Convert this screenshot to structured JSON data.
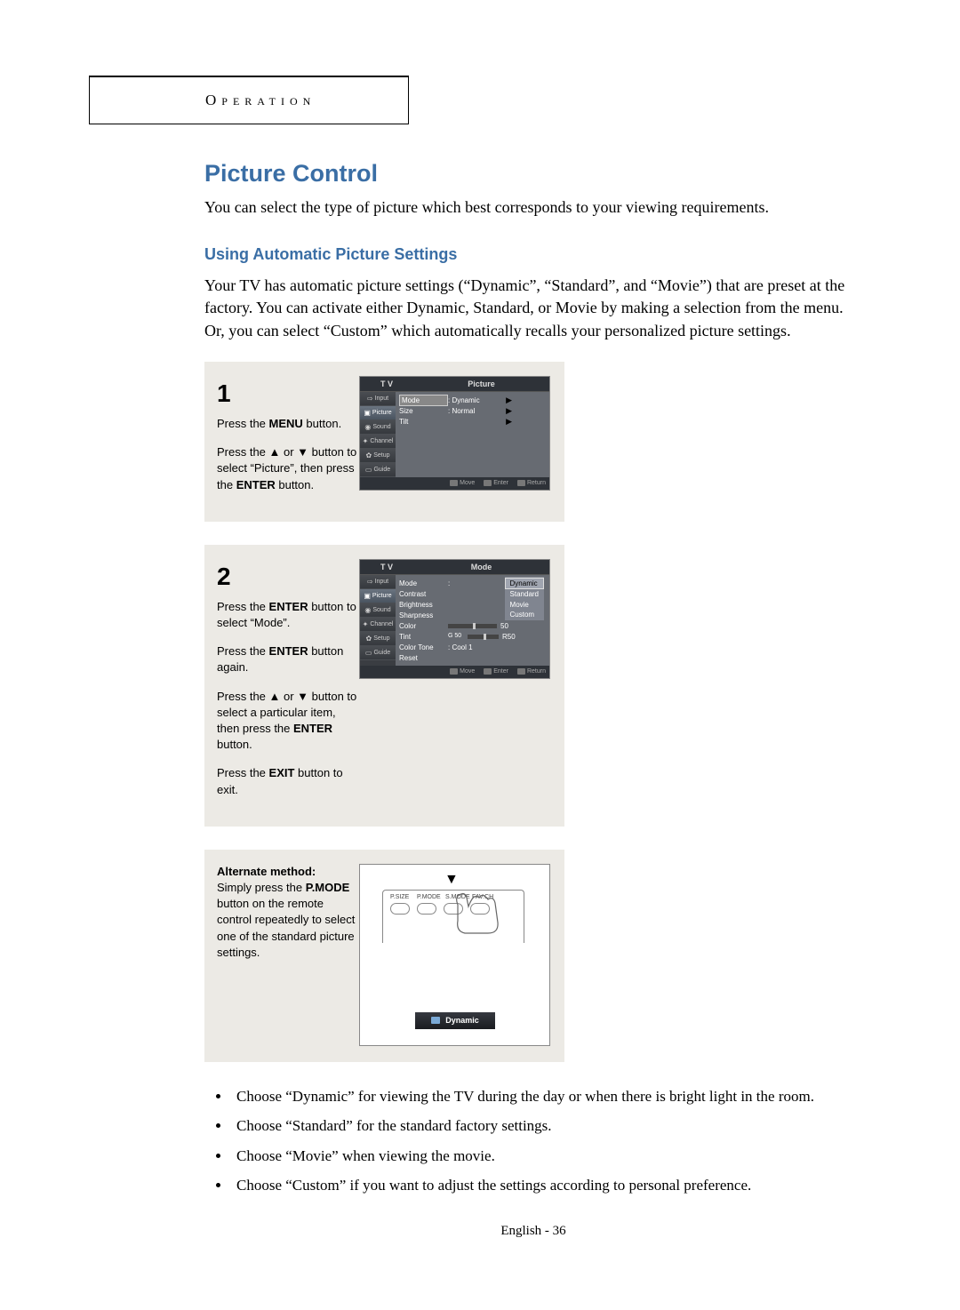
{
  "header": {
    "section": "Operation"
  },
  "title": "Picture Control",
  "intro": "You can select the type of picture which best corresponds to your viewing requirements.",
  "subheading": "Using Automatic Picture Settings",
  "body": "Your TV has automatic picture settings (“Dynamic”, “Standard”, and “Movie”) that are preset at the factory. You can activate either Dynamic, Standard, or Movie by making a selection from the menu. Or, you can select “Custom” which automatically recalls your personalized picture settings.",
  "steps": {
    "s1": {
      "num": "1",
      "p1a": "Press the ",
      "p1b": "MENU",
      "p1c": " button.",
      "p2a": "Press the ▲ or ▼ button to select “Picture”, then press the ",
      "p2b": "ENTER",
      "p2c": " button."
    },
    "s2": {
      "num": "2",
      "p1a": "Press the ",
      "p1b": "ENTER",
      "p1c": " button to select “Mode”.",
      "p2a": "Press the ",
      "p2b": "ENTER",
      "p2c": " button again.",
      "p3a": "Press the ▲ or ▼ button to select a particular item, then press the ",
      "p3b": "ENTER",
      "p3c": " button.",
      "p4a": "Press the ",
      "p4b": "EXIT",
      "p4c": " button to exit."
    },
    "alt": {
      "head": "Alternate method:",
      "p1a": "Simply press the ",
      "p1b": "P.MODE",
      "p1c": " button on the remote control repeatedly to select one of the standard picture settings."
    }
  },
  "osd1": {
    "left": "T V",
    "title": "Picture",
    "side": [
      "Input",
      "Picture",
      "Sound",
      "Channel",
      "Setup",
      "Guide"
    ],
    "rows": [
      {
        "label": "Mode",
        "value": ":   Dynamic",
        "arrow": "▶"
      },
      {
        "label": "Size",
        "value": ":   Normal",
        "arrow": "▶"
      },
      {
        "label": "Tilt",
        "value": "",
        "arrow": "▶"
      }
    ],
    "foot": [
      "Move",
      "Enter",
      "Return"
    ]
  },
  "osd2": {
    "left": "T V",
    "title": "Mode",
    "side": [
      "Input",
      "Picture",
      "Sound",
      "Channel",
      "Setup",
      "Guide"
    ],
    "pop": [
      "Dynamic",
      "Standard",
      "Movie",
      "Custom"
    ],
    "rows": [
      {
        "label": "Mode",
        "value": ":"
      },
      {
        "label": "Contrast",
        "value": ""
      },
      {
        "label": "Brightness",
        "value": ""
      },
      {
        "label": "Sharpness",
        "value": ""
      },
      {
        "label": "Color",
        "value": "",
        "right": "50"
      },
      {
        "label": "Tint",
        "value": "G 50",
        "right": "R50"
      },
      {
        "label": "Color Tone",
        "value": ":   Cool 1"
      },
      {
        "label": "Reset",
        "value": ""
      }
    ],
    "foot": [
      "Move",
      "Enter",
      "Return"
    ]
  },
  "remote": {
    "labels": [
      "P.SIZE",
      "P.MODE",
      "S.MODE",
      "FAV.CH"
    ],
    "badge": "Dynamic"
  },
  "bullets": [
    "Choose “Dynamic” for viewing the TV during the day or when there is bright light in the room.",
    "Choose “Standard” for the standard factory settings.",
    "Choose “Movie” when viewing the movie.",
    "Choose “Custom” if you want to adjust the settings according to personal preference."
  ],
  "footer": "English - 36"
}
